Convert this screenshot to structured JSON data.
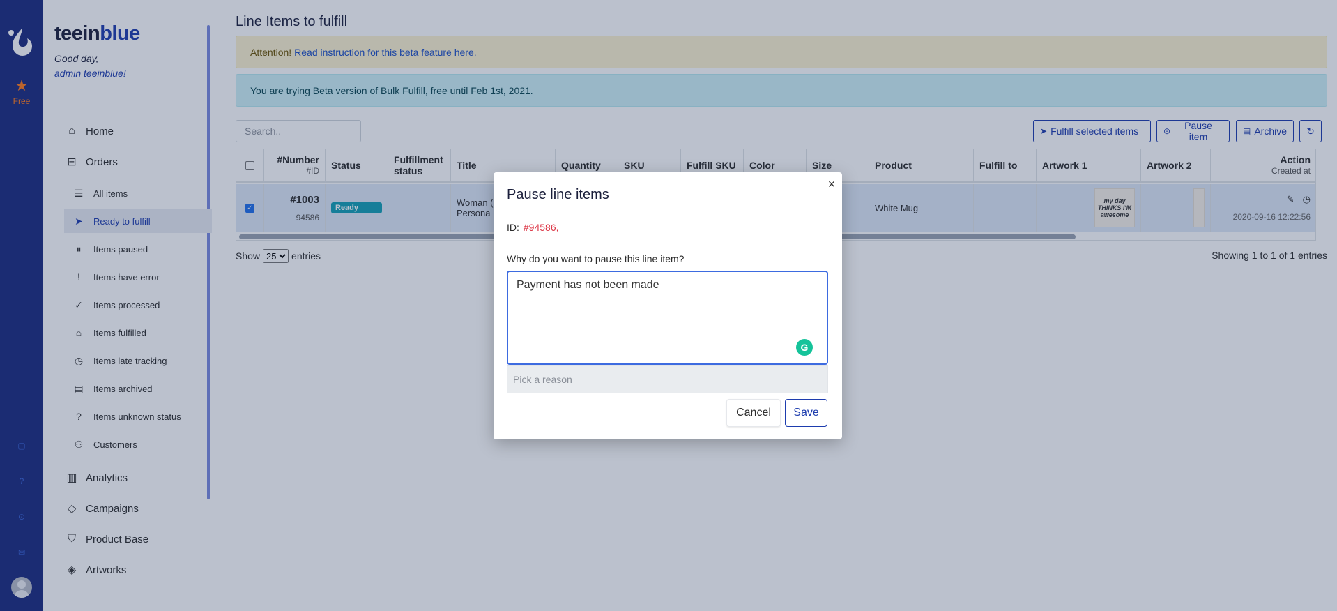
{
  "rail": {
    "free_label": "Free"
  },
  "brand": {
    "part1": "teein",
    "part2": "blue",
    "greeting": "Good day,",
    "user": "admin teeinblue!"
  },
  "sidebar": {
    "home": "Home",
    "orders": "Orders",
    "sub_items": [
      {
        "label": "All items",
        "icon": "list-icon"
      },
      {
        "label": "Ready to fulfill",
        "icon": "send-icon"
      },
      {
        "label": "Items paused",
        "icon": "pause-icon"
      },
      {
        "label": "Items have error",
        "icon": "exclamation-icon"
      },
      {
        "label": "Items processed",
        "icon": "check-icon"
      },
      {
        "label": "Items fulfilled",
        "icon": "warehouse-icon"
      },
      {
        "label": "Items late tracking",
        "icon": "clock-icon"
      },
      {
        "label": "Items archived",
        "icon": "archive-icon"
      },
      {
        "label": "Items unknown status",
        "icon": "question-icon"
      },
      {
        "label": "Customers",
        "icon": "users-icon"
      }
    ],
    "analytics": "Analytics",
    "campaigns": "Campaigns",
    "product_base": "Product Base",
    "artworks": "Artworks"
  },
  "main": {
    "title": "Line Items to fulfill",
    "alert_warn_prefix": "Attention!",
    "alert_warn_link": "Read instruction for this beta feature here.",
    "alert_info": "You are trying Beta version of Bulk Fulfill, free until Feb 1st, 2021.",
    "search_placeholder": "Search..",
    "buttons": {
      "fulfill": "Fulfill selected items",
      "pause": "Pause item",
      "archive": "Archive"
    }
  },
  "table": {
    "headers": {
      "number": "#Number",
      "number_sub": "#ID",
      "status": "Status",
      "fulfillment": "Fulfillment status",
      "title": "Title",
      "quantity": "Quantity",
      "sku": "SKU",
      "fulfill_sku": "Fulfill SKU",
      "color": "Color",
      "size": "Size",
      "product": "Product",
      "fulfill_to": "Fulfill to",
      "artwork1": "Artwork 1",
      "artwork2": "Artwork 2",
      "action": "Action",
      "action_sub": "Created at"
    },
    "row": {
      "number": "#1003",
      "id": "94586",
      "status": "Ready",
      "title_line1": "Woman (",
      "title_line2": "Persona",
      "product": "White Mug",
      "artwork_text": "my day THINKS I'M awesome",
      "created_at": "2020-09-16 12:22:56"
    }
  },
  "footer": {
    "show": "Show",
    "entries_value": "25",
    "entries": "entries",
    "showing": "Showing 1 to 1 of 1 entries"
  },
  "modal": {
    "title": "Pause line items",
    "id_label": "ID:",
    "id_value": "#94586,",
    "question": "Why do you want to pause this line item?",
    "reason_text": "Payment has not been made",
    "pick_placeholder": "Pick a reason",
    "cancel": "Cancel",
    "save": "Save"
  }
}
